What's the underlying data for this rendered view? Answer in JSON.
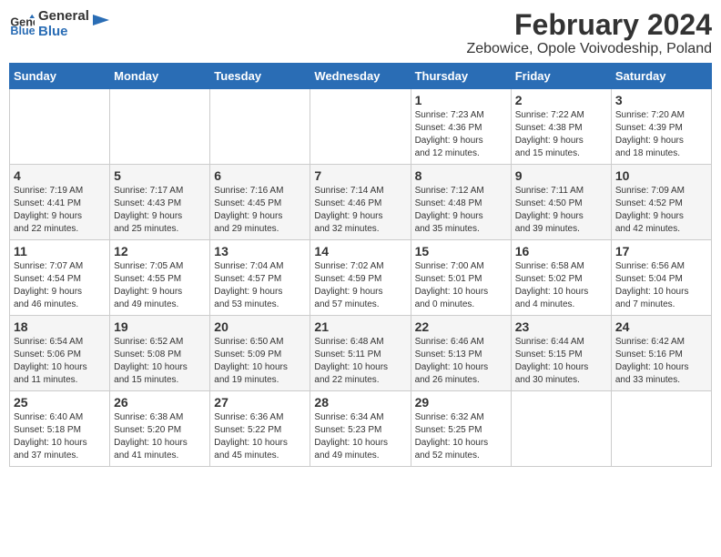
{
  "header": {
    "logo_general": "General",
    "logo_blue": "Blue",
    "month_year": "February 2024",
    "location": "Zebowice, Opole Voivodeship, Poland"
  },
  "days_of_week": [
    "Sunday",
    "Monday",
    "Tuesday",
    "Wednesday",
    "Thursday",
    "Friday",
    "Saturday"
  ],
  "weeks": [
    [
      {
        "day": "",
        "info": ""
      },
      {
        "day": "",
        "info": ""
      },
      {
        "day": "",
        "info": ""
      },
      {
        "day": "",
        "info": ""
      },
      {
        "day": "1",
        "info": "Sunrise: 7:23 AM\nSunset: 4:36 PM\nDaylight: 9 hours\nand 12 minutes."
      },
      {
        "day": "2",
        "info": "Sunrise: 7:22 AM\nSunset: 4:38 PM\nDaylight: 9 hours\nand 15 minutes."
      },
      {
        "day": "3",
        "info": "Sunrise: 7:20 AM\nSunset: 4:39 PM\nDaylight: 9 hours\nand 18 minutes."
      }
    ],
    [
      {
        "day": "4",
        "info": "Sunrise: 7:19 AM\nSunset: 4:41 PM\nDaylight: 9 hours\nand 22 minutes."
      },
      {
        "day": "5",
        "info": "Sunrise: 7:17 AM\nSunset: 4:43 PM\nDaylight: 9 hours\nand 25 minutes."
      },
      {
        "day": "6",
        "info": "Sunrise: 7:16 AM\nSunset: 4:45 PM\nDaylight: 9 hours\nand 29 minutes."
      },
      {
        "day": "7",
        "info": "Sunrise: 7:14 AM\nSunset: 4:46 PM\nDaylight: 9 hours\nand 32 minutes."
      },
      {
        "day": "8",
        "info": "Sunrise: 7:12 AM\nSunset: 4:48 PM\nDaylight: 9 hours\nand 35 minutes."
      },
      {
        "day": "9",
        "info": "Sunrise: 7:11 AM\nSunset: 4:50 PM\nDaylight: 9 hours\nand 39 minutes."
      },
      {
        "day": "10",
        "info": "Sunrise: 7:09 AM\nSunset: 4:52 PM\nDaylight: 9 hours\nand 42 minutes."
      }
    ],
    [
      {
        "day": "11",
        "info": "Sunrise: 7:07 AM\nSunset: 4:54 PM\nDaylight: 9 hours\nand 46 minutes."
      },
      {
        "day": "12",
        "info": "Sunrise: 7:05 AM\nSunset: 4:55 PM\nDaylight: 9 hours\nand 49 minutes."
      },
      {
        "day": "13",
        "info": "Sunrise: 7:04 AM\nSunset: 4:57 PM\nDaylight: 9 hours\nand 53 minutes."
      },
      {
        "day": "14",
        "info": "Sunrise: 7:02 AM\nSunset: 4:59 PM\nDaylight: 9 hours\nand 57 minutes."
      },
      {
        "day": "15",
        "info": "Sunrise: 7:00 AM\nSunset: 5:01 PM\nDaylight: 10 hours\nand 0 minutes."
      },
      {
        "day": "16",
        "info": "Sunrise: 6:58 AM\nSunset: 5:02 PM\nDaylight: 10 hours\nand 4 minutes."
      },
      {
        "day": "17",
        "info": "Sunrise: 6:56 AM\nSunset: 5:04 PM\nDaylight: 10 hours\nand 7 minutes."
      }
    ],
    [
      {
        "day": "18",
        "info": "Sunrise: 6:54 AM\nSunset: 5:06 PM\nDaylight: 10 hours\nand 11 minutes."
      },
      {
        "day": "19",
        "info": "Sunrise: 6:52 AM\nSunset: 5:08 PM\nDaylight: 10 hours\nand 15 minutes."
      },
      {
        "day": "20",
        "info": "Sunrise: 6:50 AM\nSunset: 5:09 PM\nDaylight: 10 hours\nand 19 minutes."
      },
      {
        "day": "21",
        "info": "Sunrise: 6:48 AM\nSunset: 5:11 PM\nDaylight: 10 hours\nand 22 minutes."
      },
      {
        "day": "22",
        "info": "Sunrise: 6:46 AM\nSunset: 5:13 PM\nDaylight: 10 hours\nand 26 minutes."
      },
      {
        "day": "23",
        "info": "Sunrise: 6:44 AM\nSunset: 5:15 PM\nDaylight: 10 hours\nand 30 minutes."
      },
      {
        "day": "24",
        "info": "Sunrise: 6:42 AM\nSunset: 5:16 PM\nDaylight: 10 hours\nand 33 minutes."
      }
    ],
    [
      {
        "day": "25",
        "info": "Sunrise: 6:40 AM\nSunset: 5:18 PM\nDaylight: 10 hours\nand 37 minutes."
      },
      {
        "day": "26",
        "info": "Sunrise: 6:38 AM\nSunset: 5:20 PM\nDaylight: 10 hours\nand 41 minutes."
      },
      {
        "day": "27",
        "info": "Sunrise: 6:36 AM\nSunset: 5:22 PM\nDaylight: 10 hours\nand 45 minutes."
      },
      {
        "day": "28",
        "info": "Sunrise: 6:34 AM\nSunset: 5:23 PM\nDaylight: 10 hours\nand 49 minutes."
      },
      {
        "day": "29",
        "info": "Sunrise: 6:32 AM\nSunset: 5:25 PM\nDaylight: 10 hours\nand 52 minutes."
      },
      {
        "day": "",
        "info": ""
      },
      {
        "day": "",
        "info": ""
      }
    ]
  ]
}
